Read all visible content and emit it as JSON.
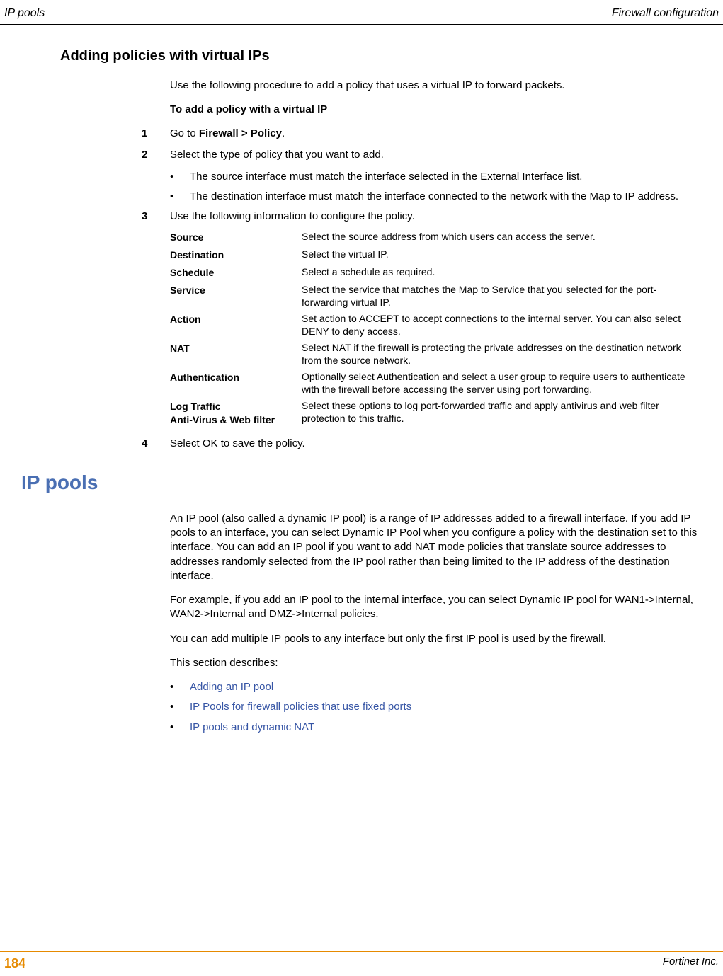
{
  "header": {
    "left": "IP pools",
    "right": "Firewall configuration"
  },
  "section1": {
    "title": "Adding policies with virtual IPs",
    "intro": "Use the following procedure to add a policy that uses a virtual IP to forward packets.",
    "proc_title": "To add a policy with a virtual IP",
    "step1_num": "1",
    "step1_a": "Go to ",
    "step1_b": "Firewall > Policy",
    "step1_c": ".",
    "step2_num": "2",
    "step2": "Select the type of policy that you want to add.",
    "step2_b1": "The source interface must match the interface selected in the External Interface list.",
    "step2_b2": "The destination interface must match the interface connected to the network with the Map to IP address.",
    "step3_num": "3",
    "step3": "Use the following information to configure the policy.",
    "table": {
      "r1t": "Source",
      "r1d": "Select the source address from which users can access the server.",
      "r2t": "Destination",
      "r2d": "Select the virtual IP.",
      "r3t": "Schedule",
      "r3d": "Select a schedule as required.",
      "r4t": "Service",
      "r4d": "Select the service that matches the Map to Service that you selected for the port-forwarding virtual IP.",
      "r5t": "Action",
      "r5d": "Set action to ACCEPT to accept connections to the internal server. You can also select DENY to deny access.",
      "r6t": "NAT",
      "r6d": "Select NAT if the firewall is protecting the private addresses on the destination network from the source network.",
      "r7t": "Authentication",
      "r7d": "Optionally select Authentication and select a user group to require users to authenticate with the firewall before accessing the server using port forwarding.",
      "r8t1": "Log Traffic",
      "r8t2": "Anti-Virus & Web filter",
      "r8d": "Select these options to log port-forwarded traffic and apply antivirus and web filter protection to this traffic."
    },
    "step4_num": "4",
    "step4": "Select OK to save the policy."
  },
  "section2": {
    "title": "IP pools",
    "p1": "An IP pool (also called a dynamic IP pool) is a range of IP addresses added to a firewall interface. If you add IP pools to an interface, you can select Dynamic IP Pool when you configure a policy with the destination set to this interface. You can add an IP pool if you want to add NAT mode policies that translate source addresses to addresses randomly selected from the IP pool rather than being limited to the IP address of the destination interface.",
    "p2": "For example, if you add an IP pool to the internal interface, you can select Dynamic IP pool for WAN1->Internal, WAN2->Internal and DMZ->Internal policies.",
    "p3": "You can add multiple IP pools to any interface but only the first IP pool is used by the firewall.",
    "p4": "This section describes:",
    "links": {
      "l1": "Adding an IP pool",
      "l2": "IP Pools for firewall policies that use fixed ports",
      "l3": "IP pools and dynamic NAT"
    }
  },
  "footer": {
    "page": "184",
    "right": "Fortinet Inc."
  }
}
